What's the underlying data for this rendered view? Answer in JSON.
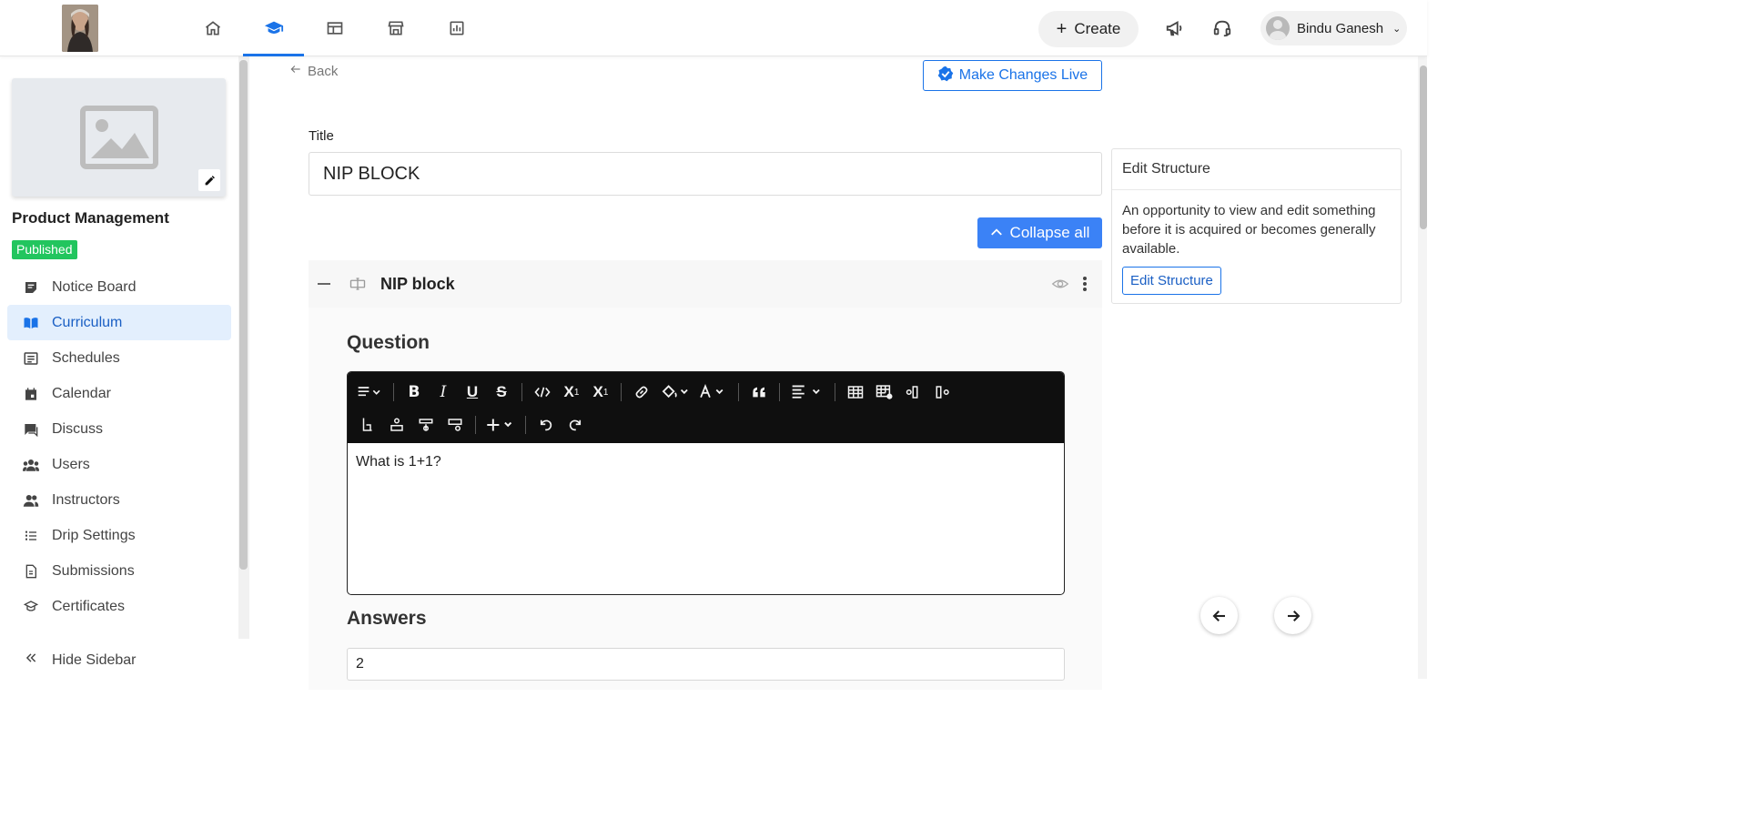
{
  "header": {
    "create_label": "Create",
    "user_name": "Bindu Ganesh",
    "nav_icons": [
      "home-icon",
      "graduation-cap-icon",
      "layout-icon",
      "store-icon",
      "analytics-icon"
    ],
    "accent_color": "#1a73e8"
  },
  "sidebar": {
    "course_name": "Product Management",
    "status_badge": "Published",
    "items": [
      {
        "label": "Notice Board",
        "icon": "notice-board-icon"
      },
      {
        "label": "Curriculum",
        "icon": "book-icon",
        "active": true
      },
      {
        "label": "Schedules",
        "icon": "list-icon"
      },
      {
        "label": "Calendar",
        "icon": "calendar-icon"
      },
      {
        "label": "Discuss",
        "icon": "chat-icon"
      },
      {
        "label": "Users",
        "icon": "users-icon"
      },
      {
        "label": "Instructors",
        "icon": "instructors-icon"
      },
      {
        "label": "Drip Settings",
        "icon": "drip-list-icon"
      },
      {
        "label": "Submissions",
        "icon": "submissions-icon"
      },
      {
        "label": "Certificates",
        "icon": "certificate-icon"
      }
    ],
    "hide_label": "Hide Sidebar"
  },
  "main": {
    "back_label": "Back",
    "make_live_label": "Make Changes Live",
    "title_label": "Title",
    "title_value": "NIP BLOCK",
    "collapse_label": "Collapse all",
    "block": {
      "title": "NIP block",
      "question_label": "Question",
      "question_text": "What is 1+1?",
      "answers_label": "Answers",
      "answer_value": "2"
    }
  },
  "structure_card": {
    "heading": "Edit Structure",
    "description": "An opportunity to view and edit something before it is acquired or becomes generally available.",
    "button_label": "Edit Structure"
  }
}
